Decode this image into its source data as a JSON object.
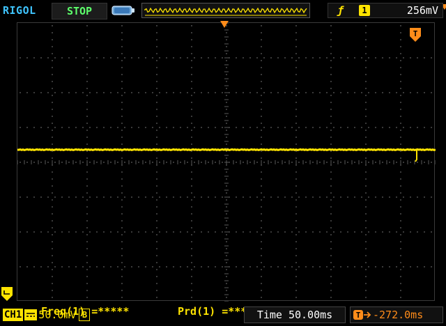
{
  "header": {
    "brand": "RIGOL",
    "run_status": "STOP",
    "battery_icon": "battery-icon",
    "memory_icon": "memory-depth-waveform-icon"
  },
  "trigger": {
    "edge_icon": "rising-edge-icon",
    "edge_glyph": "ƒ",
    "source": "1",
    "level": "256mV"
  },
  "measurements": {
    "freq": "Freq(1) =*****",
    "prd": "Prd(1) =*****"
  },
  "channel1": {
    "label": "CH1",
    "coupling_icon": "dc-coupling-icon",
    "scale": "50.0mV",
    "bandwidth_badge": "B"
  },
  "timebase": {
    "label": "Time 50.00ms"
  },
  "offset": {
    "icon": "trigger-offset-icon",
    "value": "-272.0ms"
  },
  "colors": {
    "accent_cyan": "#3fc4ff",
    "run_green": "#5dff6b",
    "channel_yellow": "#ffe400",
    "trigger_orange": "#ff8c1a",
    "grid": "#5a5a5a"
  }
}
